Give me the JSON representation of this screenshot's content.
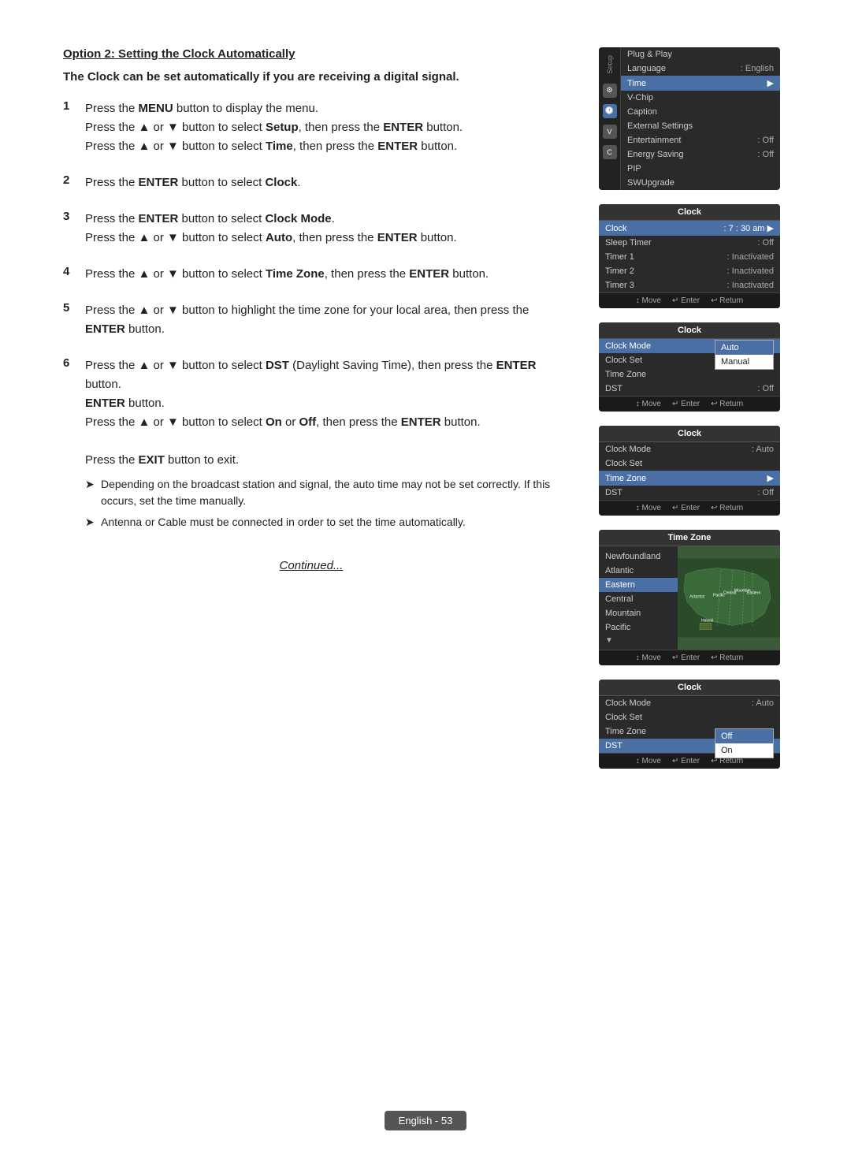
{
  "page": {
    "title": "Option 2: Setting the Clock Automatically",
    "intro": "The Clock can be set automatically if you are receiving a digital signal.",
    "steps": [
      {
        "num": "1",
        "lines": [
          "Press the <b>MENU</b> button to display the menu.",
          "Press the ▲ or ▼ button to select <b>Setup</b>, then press the <b>ENTER</b> button.",
          "Press the ▲ or ▼ button to select <b>Time</b>, then press the <b>ENTER</b> button."
        ]
      },
      {
        "num": "2",
        "lines": [
          "Press the <b>ENTER</b> button to select <b>Clock</b>."
        ]
      },
      {
        "num": "3",
        "lines": [
          "Press the <b>ENTER</b> button to select <b>Clock Mode</b>.",
          "Press the ▲ or ▼ button to select <b>Auto</b>, then press the <b>ENTER</b> button."
        ]
      },
      {
        "num": "4",
        "lines": [
          "Press the ▲ or ▼ button to select <b>Time Zone</b>, then press the <b>ENTER</b> button."
        ]
      },
      {
        "num": "5",
        "lines": [
          "Press the ▲ or ▼ button to highlight the time zone for your local area, then press the <b>ENTER</b> button."
        ]
      },
      {
        "num": "6",
        "lines": [
          "Press the ▲ or ▼ button to select <b>DST</b> (Daylight Saving Time), then press the <b>ENTER</b> button.",
          "Press the ▲ or ▼ button to select <b>On</b> or <b>Off</b>, then press the <b>ENTER</b> button."
        ]
      }
    ],
    "step6_extra": [
      "Press the <b>EXIT</b> button to exit."
    ],
    "notes": [
      "Depending on the broadcast station and signal, the auto time may not be set correctly. If this occurs, set the time manually.",
      "Antenna or Cable must be connected in order to set the time automatically."
    ],
    "continued": "Continued...",
    "footer": "English - 53"
  },
  "screens": {
    "screen1": {
      "title": "Setup",
      "items": [
        {
          "label": "Plug & Play",
          "value": ""
        },
        {
          "label": "Language",
          "value": ": English"
        },
        {
          "label": "Time",
          "value": "",
          "highlighted": true
        },
        {
          "label": "V-Chip",
          "value": ""
        },
        {
          "label": "Caption",
          "value": ""
        },
        {
          "label": "External Settings",
          "value": ""
        },
        {
          "label": "Entertainment",
          "value": ": Off"
        },
        {
          "label": "Energy Saving",
          "value": ": Off"
        },
        {
          "label": "PIP",
          "value": ""
        },
        {
          "label": "SWUpgrade",
          "value": ""
        }
      ]
    },
    "screen2": {
      "title": "Clock",
      "items": [
        {
          "label": "Clock",
          "value": ": 7 : 30 am",
          "highlighted": true
        },
        {
          "label": "Sleep Timer",
          "value": ": Off"
        },
        {
          "label": "Timer 1",
          "value": ": Inactivated"
        },
        {
          "label": "Timer 2",
          "value": ": Inactivated"
        },
        {
          "label": "Timer 3",
          "value": ": Inactivated"
        }
      ],
      "footer": [
        "↕ Move",
        "↵ Enter",
        "↩ Return"
      ]
    },
    "screen3": {
      "title": "Clock",
      "items": [
        {
          "label": "Clock Mode",
          "value": "",
          "highlighted": true
        },
        {
          "label": "Clock Set",
          "value": ""
        },
        {
          "label": "Time Zone",
          "value": ""
        },
        {
          "label": "DST",
          "value": ": Off"
        }
      ],
      "popup": [
        "Auto",
        "Manual"
      ],
      "popup_selected": "Auto",
      "footer": [
        "↕ Move",
        "↵ Enter",
        "↩ Return"
      ]
    },
    "screen4": {
      "title": "Clock",
      "items": [
        {
          "label": "Clock Mode",
          "value": ": Auto"
        },
        {
          "label": "Clock Set",
          "value": ""
        },
        {
          "label": "Time Zone",
          "value": "",
          "highlighted": true
        },
        {
          "label": "DST",
          "value": ": Off"
        }
      ],
      "footer": [
        "↕ Move",
        "↵ Enter",
        "↩ Return"
      ]
    },
    "screen5": {
      "title": "Time Zone",
      "zones": [
        "Newfoundland",
        "Atlantic",
        "Eastern",
        "Central",
        "Mountain",
        "Pacific"
      ],
      "selected": "Eastern",
      "footer": [
        "↕ Move",
        "↵ Enter",
        "↩ Return"
      ]
    },
    "screen6": {
      "title": "Clock",
      "items": [
        {
          "label": "Clock Mode",
          "value": ": Auto"
        },
        {
          "label": "Clock Set",
          "value": ""
        },
        {
          "label": "Time Zone",
          "value": ""
        },
        {
          "label": "DST",
          "value": "",
          "highlighted": true
        }
      ],
      "popup": [
        "Off",
        "On"
      ],
      "popup_selected": "Off",
      "footer": [
        "↕ Move",
        "↵ Enter",
        "↩ Return"
      ]
    }
  }
}
